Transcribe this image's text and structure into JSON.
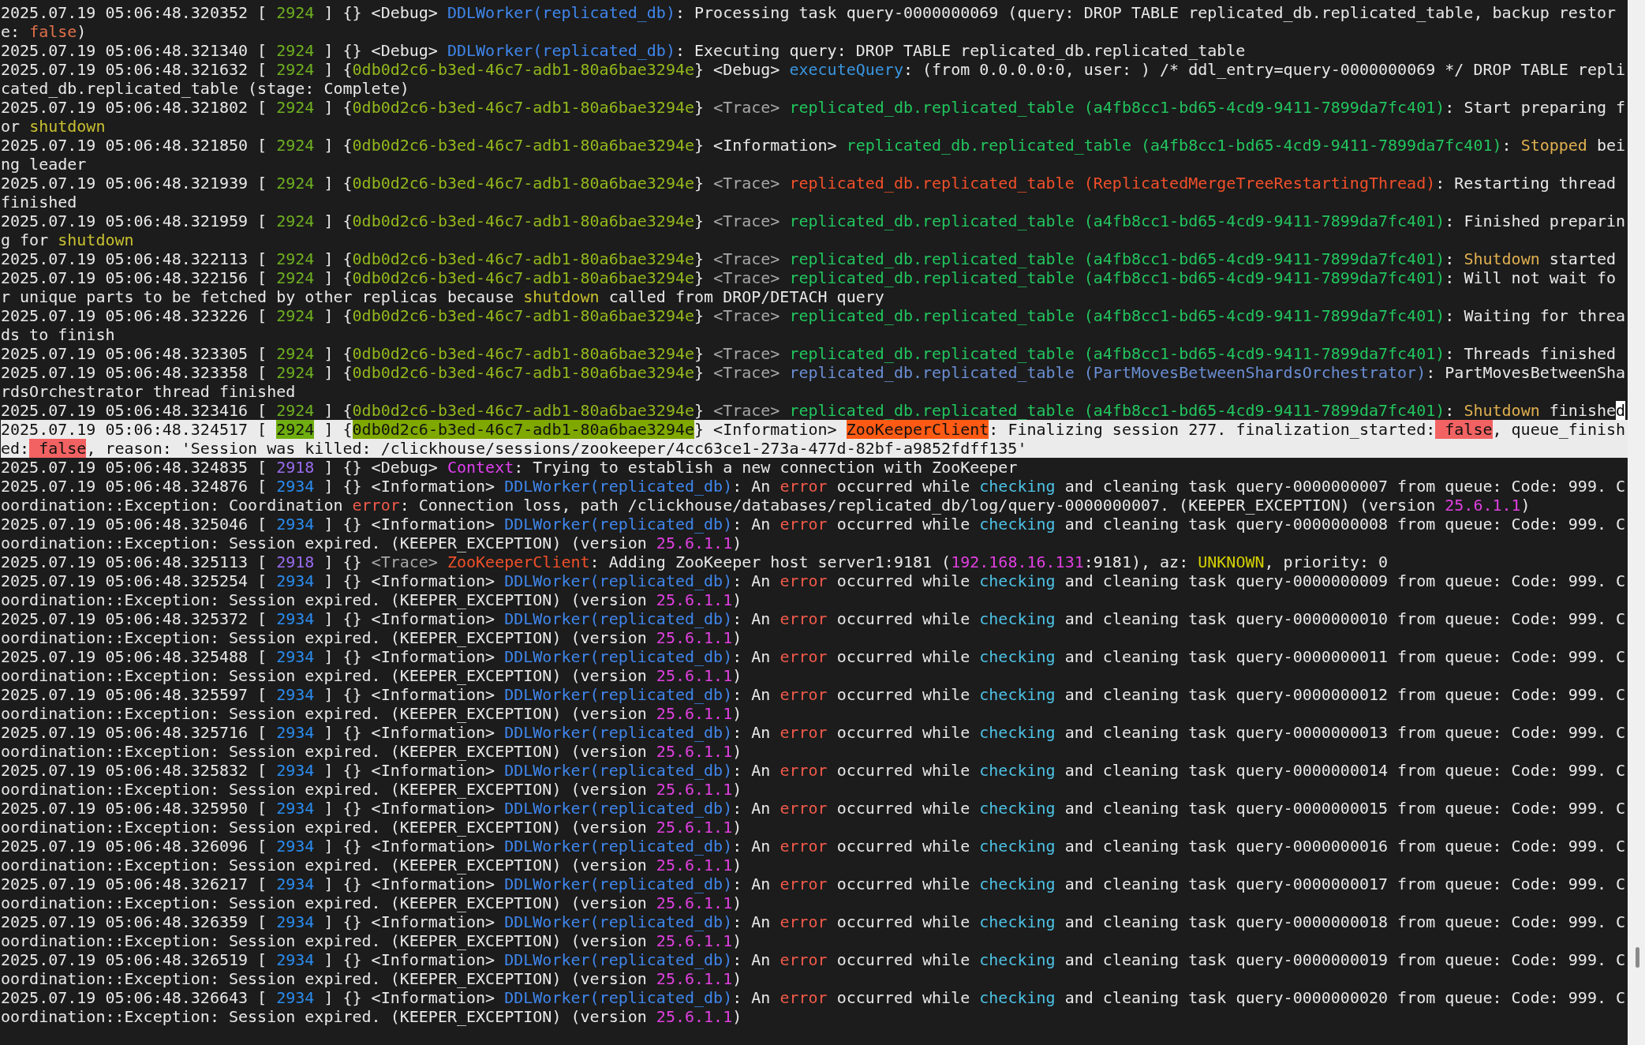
{
  "entries": [
    {
      "selected": false,
      "segments": [
        {
          "text": "2025.07.19 05:06:48.320352 [ "
        },
        {
          "text": "2924",
          "color": "#6fb020"
        },
        {
          "text": " ] {} <Debug> "
        },
        {
          "text": "DDLWorker(replicated_db)",
          "color": "#3f86ec"
        },
        {
          "text": ": Processing task query-0000000069 (query: DROP TABLE replicated_db.replicated_table, backup restore: "
        },
        {
          "text": "false",
          "color": "#e0704a"
        },
        {
          "text": ")"
        }
      ]
    },
    {
      "selected": false,
      "segments": [
        {
          "text": "2025.07.19 05:06:48.321340 [ "
        },
        {
          "text": "2924",
          "color": "#6fb020"
        },
        {
          "text": " ] {} <Debug> "
        },
        {
          "text": "DDLWorker(replicated_db)",
          "color": "#3f86ec"
        },
        {
          "text": ": Executing query: DROP TABLE replicated_db.replicated_table"
        }
      ]
    },
    {
      "selected": false,
      "segments": [
        {
          "text": "2025.07.19 05:06:48.321632 [ "
        },
        {
          "text": "2924",
          "color": "#6fb020"
        },
        {
          "text": " ] {"
        },
        {
          "text": "0db0d2c6-b3ed-46c7-adb1-80a6bae3294e",
          "color": "#93b81c"
        },
        {
          "text": "} <Debug> "
        },
        {
          "text": "executeQuery",
          "color": "#3a96e0"
        },
        {
          "text": ": (from 0.0.0.0:0, user: ) /* ddl_entry=query-0000000069 */ DROP TABLE replicated_db.replicated_table (stage: Complete)"
        }
      ]
    },
    {
      "selected": false,
      "segments": [
        {
          "text": "2025.07.19 05:06:48.321802 [ "
        },
        {
          "text": "2924",
          "color": "#6fb020"
        },
        {
          "text": " ] {"
        },
        {
          "text": "0db0d2c6-b3ed-46c7-adb1-80a6bae3294e",
          "color": "#93b81c"
        },
        {
          "text": "} "
        },
        {
          "text": "<Trace> ",
          "color": "#a8a8a8"
        },
        {
          "text": "replicated_db.replicated_table (a4fb8cc1-bd65-4cd9-9411-7899da7fc401)",
          "color": "#22c55e"
        },
        {
          "text": ": Start preparing for "
        },
        {
          "text": "shutdown",
          "color": "#c8c030"
        }
      ]
    },
    {
      "selected": false,
      "segments": [
        {
          "text": "2025.07.19 05:06:48.321850 [ "
        },
        {
          "text": "2924",
          "color": "#6fb020"
        },
        {
          "text": " ] {"
        },
        {
          "text": "0db0d2c6-b3ed-46c7-adb1-80a6bae3294e",
          "color": "#93b81c"
        },
        {
          "text": "} <Information> "
        },
        {
          "text": "replicated_db.replicated_table (a4fb8cc1-bd65-4cd9-9411-7899da7fc401)",
          "color": "#22c55e"
        },
        {
          "text": ": "
        },
        {
          "text": "Stopped",
          "color": "#e0b050"
        },
        {
          "text": " being leader"
        }
      ]
    },
    {
      "selected": false,
      "segments": [
        {
          "text": "2025.07.19 05:06:48.321939 [ "
        },
        {
          "text": "2924",
          "color": "#6fb020"
        },
        {
          "text": " ] {"
        },
        {
          "text": "0db0d2c6-b3ed-46c7-adb1-80a6bae3294e",
          "color": "#93b81c"
        },
        {
          "text": "} "
        },
        {
          "text": "<Trace> ",
          "color": "#a8a8a8"
        },
        {
          "text": "replicated_db.replicated_table (ReplicatedMergeTreeRestartingThread)",
          "color": "#f0502a"
        },
        {
          "text": ": Restarting thread finished"
        }
      ]
    },
    {
      "selected": false,
      "segments": [
        {
          "text": "2025.07.19 05:06:48.321959 [ "
        },
        {
          "text": "2924",
          "color": "#6fb020"
        },
        {
          "text": " ] {"
        },
        {
          "text": "0db0d2c6-b3ed-46c7-adb1-80a6bae3294e",
          "color": "#93b81c"
        },
        {
          "text": "} "
        },
        {
          "text": "<Trace> ",
          "color": "#a8a8a8"
        },
        {
          "text": "replicated_db.replicated_table (a4fb8cc1-bd65-4cd9-9411-7899da7fc401)",
          "color": "#22c55e"
        },
        {
          "text": ": Finished preparing for "
        },
        {
          "text": "shutdown",
          "color": "#c8c030"
        }
      ]
    },
    {
      "selected": false,
      "segments": [
        {
          "text": "2025.07.19 05:06:48.322113 [ "
        },
        {
          "text": "2924",
          "color": "#6fb020"
        },
        {
          "text": " ] {"
        },
        {
          "text": "0db0d2c6-b3ed-46c7-adb1-80a6bae3294e",
          "color": "#93b81c"
        },
        {
          "text": "} "
        },
        {
          "text": "<Trace> ",
          "color": "#a8a8a8"
        },
        {
          "text": "replicated_db.replicated_table (a4fb8cc1-bd65-4cd9-9411-7899da7fc401)",
          "color": "#22c55e"
        },
        {
          "text": ": "
        },
        {
          "text": "Shutdown",
          "color": "#e0b050"
        },
        {
          "text": " started"
        }
      ]
    },
    {
      "selected": false,
      "segments": [
        {
          "text": "2025.07.19 05:06:48.322156 [ "
        },
        {
          "text": "2924",
          "color": "#6fb020"
        },
        {
          "text": " ] {"
        },
        {
          "text": "0db0d2c6-b3ed-46c7-adb1-80a6bae3294e",
          "color": "#93b81c"
        },
        {
          "text": "} "
        },
        {
          "text": "<Trace> ",
          "color": "#a8a8a8"
        },
        {
          "text": "replicated_db.replicated_table (a4fb8cc1-bd65-4cd9-9411-7899da7fc401)",
          "color": "#22c55e"
        },
        {
          "text": ": Will not wait for unique parts to be fetched by other replicas because "
        },
        {
          "text": "shutdown",
          "color": "#c8c030"
        },
        {
          "text": " called from DROP/DETACH query"
        }
      ]
    },
    {
      "selected": false,
      "segments": [
        {
          "text": "2025.07.19 05:06:48.323226 [ "
        },
        {
          "text": "2924",
          "color": "#6fb020"
        },
        {
          "text": " ] {"
        },
        {
          "text": "0db0d2c6-b3ed-46c7-adb1-80a6bae3294e",
          "color": "#93b81c"
        },
        {
          "text": "} "
        },
        {
          "text": "<Trace> ",
          "color": "#a8a8a8"
        },
        {
          "text": "replicated_db.replicated_table (a4fb8cc1-bd65-4cd9-9411-7899da7fc401)",
          "color": "#22c55e"
        },
        {
          "text": ": Waiting for threads to finish"
        }
      ]
    },
    {
      "selected": false,
      "segments": [
        {
          "text": "2025.07.19 05:06:48.323305 [ "
        },
        {
          "text": "2924",
          "color": "#6fb020"
        },
        {
          "text": " ] {"
        },
        {
          "text": "0db0d2c6-b3ed-46c7-adb1-80a6bae3294e",
          "color": "#93b81c"
        },
        {
          "text": "} "
        },
        {
          "text": "<Trace> ",
          "color": "#a8a8a8"
        },
        {
          "text": "replicated_db.replicated_table (a4fb8cc1-bd65-4cd9-9411-7899da7fc401)",
          "color": "#22c55e"
        },
        {
          "text": ": Threads finished"
        }
      ]
    },
    {
      "selected": false,
      "segments": [
        {
          "text": "2025.07.19 05:06:48.323358 [ "
        },
        {
          "text": "2924",
          "color": "#6fb020"
        },
        {
          "text": " ] {"
        },
        {
          "text": "0db0d2c6-b3ed-46c7-adb1-80a6bae3294e",
          "color": "#93b81c"
        },
        {
          "text": "} "
        },
        {
          "text": "<Trace> ",
          "color": "#a8a8a8"
        },
        {
          "text": "replicated_db.replicated_table (PartMovesBetweenShardsOrchestrator)",
          "color": "#6a8ed4"
        },
        {
          "text": ": PartMovesBetweenShardsOrchestrator thread finished"
        }
      ]
    },
    {
      "selected": false,
      "segments": [
        {
          "text": "2025.07.19 05:06:48.323416 [ "
        },
        {
          "text": "2924",
          "color": "#6fb020"
        },
        {
          "text": " ] {"
        },
        {
          "text": "0db0d2c6-b3ed-46c7-adb1-80a6bae3294e",
          "color": "#93b81c"
        },
        {
          "text": "} "
        },
        {
          "text": "<Trace> ",
          "color": "#a8a8a8"
        },
        {
          "text": "replicated_db.replicated_table (a4fb8cc1-bd65-4cd9-9411-7899da7fc401)",
          "color": "#22c55e"
        },
        {
          "text": ": "
        },
        {
          "text": "Shutdown",
          "color": "#e0b050"
        },
        {
          "text": " finishe"
        },
        {
          "text": "d",
          "kind": "cursor"
        }
      ]
    },
    {
      "selected": true,
      "segments": [
        {
          "text": "2025.07.19 05:06:48.324517 [ "
        },
        {
          "text": "2924",
          "kind": "highlight",
          "color": "#6fae10"
        },
        {
          "text": " ] {"
        },
        {
          "text": "0db0d2c6-b3ed-46c7-adb1-80a6bae3294e",
          "kind": "highlight",
          "color": "#7fa800"
        },
        {
          "text": "} <Information> "
        },
        {
          "text": "ZooKeeperClient",
          "kind": "highlight",
          "color": "#ff5a14"
        },
        {
          "text": ": Finalizing session 277. finalization_started:"
        },
        {
          "text": " false",
          "kind": "highlight",
          "color": "#f26262"
        },
        {
          "text": ", queue_finished:"
        },
        {
          "text": " false",
          "kind": "highlight",
          "color": "#f26262"
        },
        {
          "text": ", reason: 'Session was killed: /clickhouse/sessions/zookeeper/4cc63ce1-273a-477d-82bf-a9852fdff135'"
        }
      ]
    },
    {
      "selected": false,
      "segments": [
        {
          "text": "2025.07.19 05:06:48.324835 [ "
        },
        {
          "text": "2918",
          "color": "#9a6cf0"
        },
        {
          "text": " ] {} <Debug> "
        },
        {
          "text": "Context",
          "color": "#e040f0"
        },
        {
          "text": ": Trying to establish a new connection with ZooKeeper"
        }
      ]
    },
    {
      "selected": false,
      "segments": [
        {
          "text": "2025.07.19 05:06:48.324876 [ "
        },
        {
          "text": "2934",
          "color": "#2a8cf0"
        },
        {
          "text": " ] {} <Information> "
        },
        {
          "text": "DDLWorker(replicated_db)",
          "color": "#3f86ec"
        },
        {
          "text": ": An "
        },
        {
          "text": "error",
          "color": "#f05a4a"
        },
        {
          "text": " occurred while "
        },
        {
          "text": "checking",
          "color": "#4ec3e6"
        },
        {
          "text": " and cleaning task query-0000000007 from queue: Code: 999. Coordination::Exception: Coordination "
        },
        {
          "text": "error",
          "color": "#f05a4a"
        },
        {
          "text": ": Connection loss, path /clickhouse/databases/replicated_db/log/query-0000000007. (KEEPER_EXCEPTION) (version "
        },
        {
          "text": "25.6.1.1",
          "color": "#e040e0"
        },
        {
          "text": ")"
        }
      ]
    },
    {
      "selected": false,
      "segments": [
        {
          "text": "2025.07.19 05:06:48.325046 [ "
        },
        {
          "text": "2934",
          "color": "#2a8cf0"
        },
        {
          "text": " ] {} <Information> "
        },
        {
          "text": "DDLWorker(replicated_db)",
          "color": "#3f86ec"
        },
        {
          "text": ": An "
        },
        {
          "text": "error",
          "color": "#f05a4a"
        },
        {
          "text": " occurred while "
        },
        {
          "text": "checking",
          "color": "#4ec3e6"
        },
        {
          "text": " and cleaning task query-0000000008 from queue: Code: 999. Coordination::Exception: Session expired. (KEEPER_EXCEPTION) (version "
        },
        {
          "text": "25.6.1.1",
          "color": "#e040e0"
        },
        {
          "text": ")"
        }
      ]
    },
    {
      "selected": false,
      "segments": [
        {
          "text": "2025.07.19 05:06:48.325113 [ "
        },
        {
          "text": "2918",
          "color": "#9a6cf0"
        },
        {
          "text": " ] {} "
        },
        {
          "text": "<Trace> ",
          "color": "#a8a8a8"
        },
        {
          "text": "ZooKeeperClient",
          "color": "#f0502a"
        },
        {
          "text": ": Adding ZooKeeper host server1:9181 ("
        },
        {
          "text": "192.168.16.131",
          "color": "#e040e0"
        },
        {
          "text": ":9181), az: "
        },
        {
          "text": "UNKNOWN",
          "color": "#d4d000"
        },
        {
          "text": ", priority: 0"
        }
      ]
    },
    {
      "selected": false,
      "segments": [
        {
          "text": "2025.07.19 05:06:48.325254 [ "
        },
        {
          "text": "2934",
          "color": "#2a8cf0"
        },
        {
          "text": " ] {} <Information> "
        },
        {
          "text": "DDLWorker(replicated_db)",
          "color": "#3f86ec"
        },
        {
          "text": ": An "
        },
        {
          "text": "error",
          "color": "#f05a4a"
        },
        {
          "text": " occurred while "
        },
        {
          "text": "checking",
          "color": "#4ec3e6"
        },
        {
          "text": " and cleaning task query-0000000009 from queue: Code: 999. Coordination::Exception: Session expired. (KEEPER_EXCEPTION) (version "
        },
        {
          "text": "25.6.1.1",
          "color": "#e040e0"
        },
        {
          "text": ")"
        }
      ]
    },
    {
      "selected": false,
      "segments": [
        {
          "text": "2025.07.19 05:06:48.325372 [ "
        },
        {
          "text": "2934",
          "color": "#2a8cf0"
        },
        {
          "text": " ] {} <Information> "
        },
        {
          "text": "DDLWorker(replicated_db)",
          "color": "#3f86ec"
        },
        {
          "text": ": An "
        },
        {
          "text": "error",
          "color": "#f05a4a"
        },
        {
          "text": " occurred while "
        },
        {
          "text": "checking",
          "color": "#4ec3e6"
        },
        {
          "text": " and cleaning task query-0000000010 from queue: Code: 999. Coordination::Exception: Session expired. (KEEPER_EXCEPTION) (version "
        },
        {
          "text": "25.6.1.1",
          "color": "#e040e0"
        },
        {
          "text": ")"
        }
      ]
    },
    {
      "selected": false,
      "segments": [
        {
          "text": "2025.07.19 05:06:48.325488 [ "
        },
        {
          "text": "2934",
          "color": "#2a8cf0"
        },
        {
          "text": " ] {} <Information> "
        },
        {
          "text": "DDLWorker(replicated_db)",
          "color": "#3f86ec"
        },
        {
          "text": ": An "
        },
        {
          "text": "error",
          "color": "#f05a4a"
        },
        {
          "text": " occurred while "
        },
        {
          "text": "checking",
          "color": "#4ec3e6"
        },
        {
          "text": " and cleaning task query-0000000011 from queue: Code: 999. Coordination::Exception: Session expired. (KEEPER_EXCEPTION) (version "
        },
        {
          "text": "25.6.1.1",
          "color": "#e040e0"
        },
        {
          "text": ")"
        }
      ]
    },
    {
      "selected": false,
      "segments": [
        {
          "text": "2025.07.19 05:06:48.325597 [ "
        },
        {
          "text": "2934",
          "color": "#2a8cf0"
        },
        {
          "text": " ] {} <Information> "
        },
        {
          "text": "DDLWorker(replicated_db)",
          "color": "#3f86ec"
        },
        {
          "text": ": An "
        },
        {
          "text": "error",
          "color": "#f05a4a"
        },
        {
          "text": " occurred while "
        },
        {
          "text": "checking",
          "color": "#4ec3e6"
        },
        {
          "text": " and cleaning task query-0000000012 from queue: Code: 999. Coordination::Exception: Session expired. (KEEPER_EXCEPTION) (version "
        },
        {
          "text": "25.6.1.1",
          "color": "#e040e0"
        },
        {
          "text": ")"
        }
      ]
    },
    {
      "selected": false,
      "segments": [
        {
          "text": "2025.07.19 05:06:48.325716 [ "
        },
        {
          "text": "2934",
          "color": "#2a8cf0"
        },
        {
          "text": " ] {} <Information> "
        },
        {
          "text": "DDLWorker(replicated_db)",
          "color": "#3f86ec"
        },
        {
          "text": ": An "
        },
        {
          "text": "error",
          "color": "#f05a4a"
        },
        {
          "text": " occurred while "
        },
        {
          "text": "checking",
          "color": "#4ec3e6"
        },
        {
          "text": " and cleaning task query-0000000013 from queue: Code: 999. Coordination::Exception: Session expired. (KEEPER_EXCEPTION) (version "
        },
        {
          "text": "25.6.1.1",
          "color": "#e040e0"
        },
        {
          "text": ")"
        }
      ]
    },
    {
      "selected": false,
      "segments": [
        {
          "text": "2025.07.19 05:06:48.325832 [ "
        },
        {
          "text": "2934",
          "color": "#2a8cf0"
        },
        {
          "text": " ] {} <Information> "
        },
        {
          "text": "DDLWorker(replicated_db)",
          "color": "#3f86ec"
        },
        {
          "text": ": An "
        },
        {
          "text": "error",
          "color": "#f05a4a"
        },
        {
          "text": " occurred while "
        },
        {
          "text": "checking",
          "color": "#4ec3e6"
        },
        {
          "text": " and cleaning task query-0000000014 from queue: Code: 999. Coordination::Exception: Session expired. (KEEPER_EXCEPTION) (version "
        },
        {
          "text": "25.6.1.1",
          "color": "#e040e0"
        },
        {
          "text": ")"
        }
      ]
    },
    {
      "selected": false,
      "segments": [
        {
          "text": "2025.07.19 05:06:48.325950 [ "
        },
        {
          "text": "2934",
          "color": "#2a8cf0"
        },
        {
          "text": " ] {} <Information> "
        },
        {
          "text": "DDLWorker(replicated_db)",
          "color": "#3f86ec"
        },
        {
          "text": ": An "
        },
        {
          "text": "error",
          "color": "#f05a4a"
        },
        {
          "text": " occurred while "
        },
        {
          "text": "checking",
          "color": "#4ec3e6"
        },
        {
          "text": " and cleaning task query-0000000015 from queue: Code: 999. Coordination::Exception: Session expired. (KEEPER_EXCEPTION) (version "
        },
        {
          "text": "25.6.1.1",
          "color": "#e040e0"
        },
        {
          "text": ")"
        }
      ]
    },
    {
      "selected": false,
      "segments": [
        {
          "text": "2025.07.19 05:06:48.326096 [ "
        },
        {
          "text": "2934",
          "color": "#2a8cf0"
        },
        {
          "text": " ] {} <Information> "
        },
        {
          "text": "DDLWorker(replicated_db)",
          "color": "#3f86ec"
        },
        {
          "text": ": An "
        },
        {
          "text": "error",
          "color": "#f05a4a"
        },
        {
          "text": " occurred while "
        },
        {
          "text": "checking",
          "color": "#4ec3e6"
        },
        {
          "text": " and cleaning task query-0000000016 from queue: Code: 999. Coordination::Exception: Session expired. (KEEPER_EXCEPTION) (version "
        },
        {
          "text": "25.6.1.1",
          "color": "#e040e0"
        },
        {
          "text": ")"
        }
      ]
    },
    {
      "selected": false,
      "segments": [
        {
          "text": "2025.07.19 05:06:48.326217 [ "
        },
        {
          "text": "2934",
          "color": "#2a8cf0"
        },
        {
          "text": " ] {} <Information> "
        },
        {
          "text": "DDLWorker(replicated_db)",
          "color": "#3f86ec"
        },
        {
          "text": ": An "
        },
        {
          "text": "error",
          "color": "#f05a4a"
        },
        {
          "text": " occurred while "
        },
        {
          "text": "checking",
          "color": "#4ec3e6"
        },
        {
          "text": " and cleaning task query-0000000017 from queue: Code: 999. Coordination::Exception: Session expired. (KEEPER_EXCEPTION) (version "
        },
        {
          "text": "25.6.1.1",
          "color": "#e040e0"
        },
        {
          "text": ")"
        }
      ]
    },
    {
      "selected": false,
      "segments": [
        {
          "text": "2025.07.19 05:06:48.326359 [ "
        },
        {
          "text": "2934",
          "color": "#2a8cf0"
        },
        {
          "text": " ] {} <Information> "
        },
        {
          "text": "DDLWorker(replicated_db)",
          "color": "#3f86ec"
        },
        {
          "text": ": An "
        },
        {
          "text": "error",
          "color": "#f05a4a"
        },
        {
          "text": " occurred while "
        },
        {
          "text": "checking",
          "color": "#4ec3e6"
        },
        {
          "text": " and cleaning task query-0000000018 from queue: Code: 999. Coordination::Exception: Session expired. (KEEPER_EXCEPTION) (version "
        },
        {
          "text": "25.6.1.1",
          "color": "#e040e0"
        },
        {
          "text": ")"
        }
      ]
    },
    {
      "selected": false,
      "segments": [
        {
          "text": "2025.07.19 05:06:48.326519 [ "
        },
        {
          "text": "2934",
          "color": "#2a8cf0"
        },
        {
          "text": " ] {} <Information> "
        },
        {
          "text": "DDLWorker(replicated_db)",
          "color": "#3f86ec"
        },
        {
          "text": ": An "
        },
        {
          "text": "error",
          "color": "#f05a4a"
        },
        {
          "text": " occurred while "
        },
        {
          "text": "checking",
          "color": "#4ec3e6"
        },
        {
          "text": " and cleaning task query-0000000019 from queue: Code: 999. Coordination::Exception: Session expired. (KEEPER_EXCEPTION) (version "
        },
        {
          "text": "25.6.1.1",
          "color": "#e040e0"
        },
        {
          "text": ")"
        }
      ]
    },
    {
      "selected": false,
      "segments": [
        {
          "text": "2025.07.19 05:06:48.326643 [ "
        },
        {
          "text": "2934",
          "color": "#2a8cf0"
        },
        {
          "text": " ] {} <Information> "
        },
        {
          "text": "DDLWorker(replicated_db)",
          "color": "#3f86ec"
        },
        {
          "text": ": An "
        },
        {
          "text": "error",
          "color": "#f05a4a"
        },
        {
          "text": " occurred while "
        },
        {
          "text": "checking",
          "color": "#4ec3e6"
        },
        {
          "text": " and cleaning task query-0000000020 from queue: Code: 999. Coordination::Exception: Session expired. (KEEPER_EXCEPTION) (version "
        },
        {
          "text": "25.6.1.1",
          "color": "#e040e0"
        },
        {
          "text": ")"
        }
      ]
    }
  ]
}
